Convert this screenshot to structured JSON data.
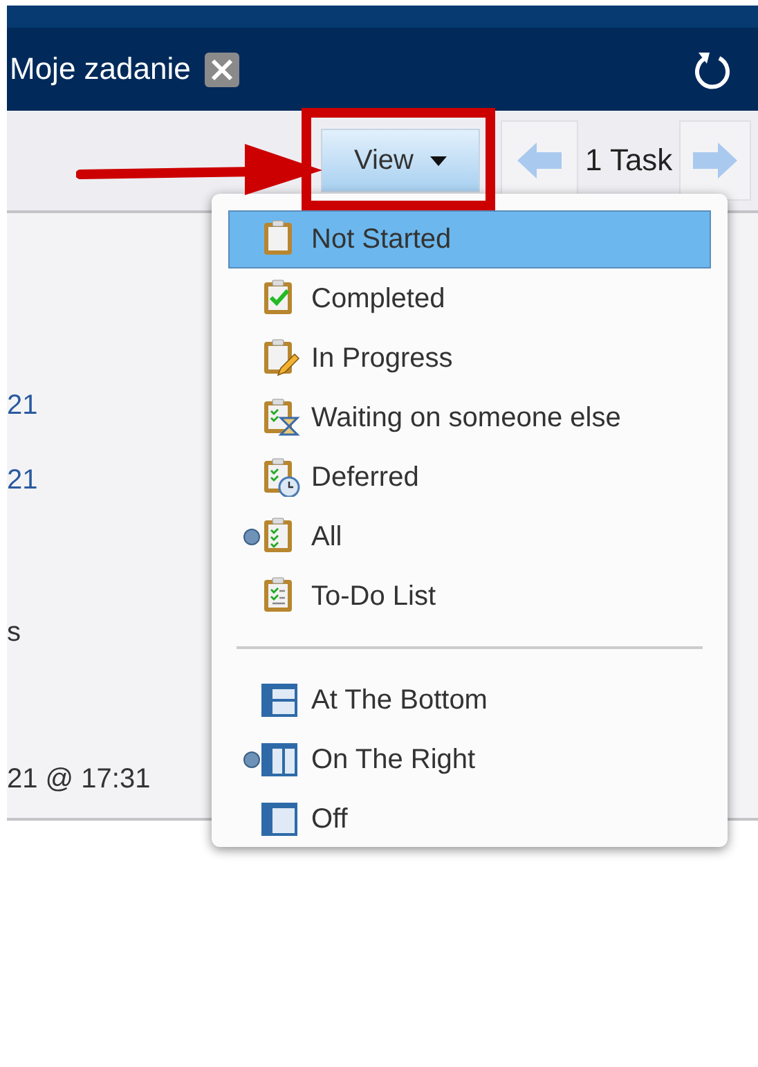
{
  "header": {
    "tab_title": "Moje zadanie"
  },
  "toolbar": {
    "view_button": "View",
    "task_count": "1 Task"
  },
  "content": [
    {
      "kind": "link",
      "text": "21"
    },
    {
      "kind": "link",
      "text": "21"
    },
    {
      "kind": "plain",
      "text": "s"
    },
    {
      "kind": "plain",
      "text": "21 @ 17:31"
    }
  ],
  "view_menu": {
    "sections": [
      [
        {
          "label": "Not Started",
          "kind": "blank",
          "selected": false,
          "highlighted": true
        },
        {
          "label": "Completed",
          "kind": "check",
          "selected": false,
          "highlighted": false
        },
        {
          "label": "In Progress",
          "kind": "pencil",
          "selected": false,
          "highlighted": false
        },
        {
          "label": "Waiting on someone else",
          "kind": "hourglass",
          "selected": false,
          "highlighted": false
        },
        {
          "label": "Deferred",
          "kind": "clock",
          "selected": false,
          "highlighted": false
        },
        {
          "label": "All",
          "kind": "all",
          "selected": true,
          "highlighted": false
        },
        {
          "label": "To-Do List",
          "kind": "list",
          "selected": false,
          "highlighted": false
        }
      ],
      [
        {
          "label": "At The Bottom",
          "kind": "pane-bottom",
          "selected": false,
          "highlighted": false
        },
        {
          "label": "On The Right",
          "kind": "pane-right",
          "selected": true,
          "highlighted": false
        },
        {
          "label": "Off",
          "kind": "pane-off",
          "selected": false,
          "highlighted": false
        }
      ]
    ]
  },
  "annotations": {
    "highlight_frame": true,
    "pointer_arrow": true
  }
}
